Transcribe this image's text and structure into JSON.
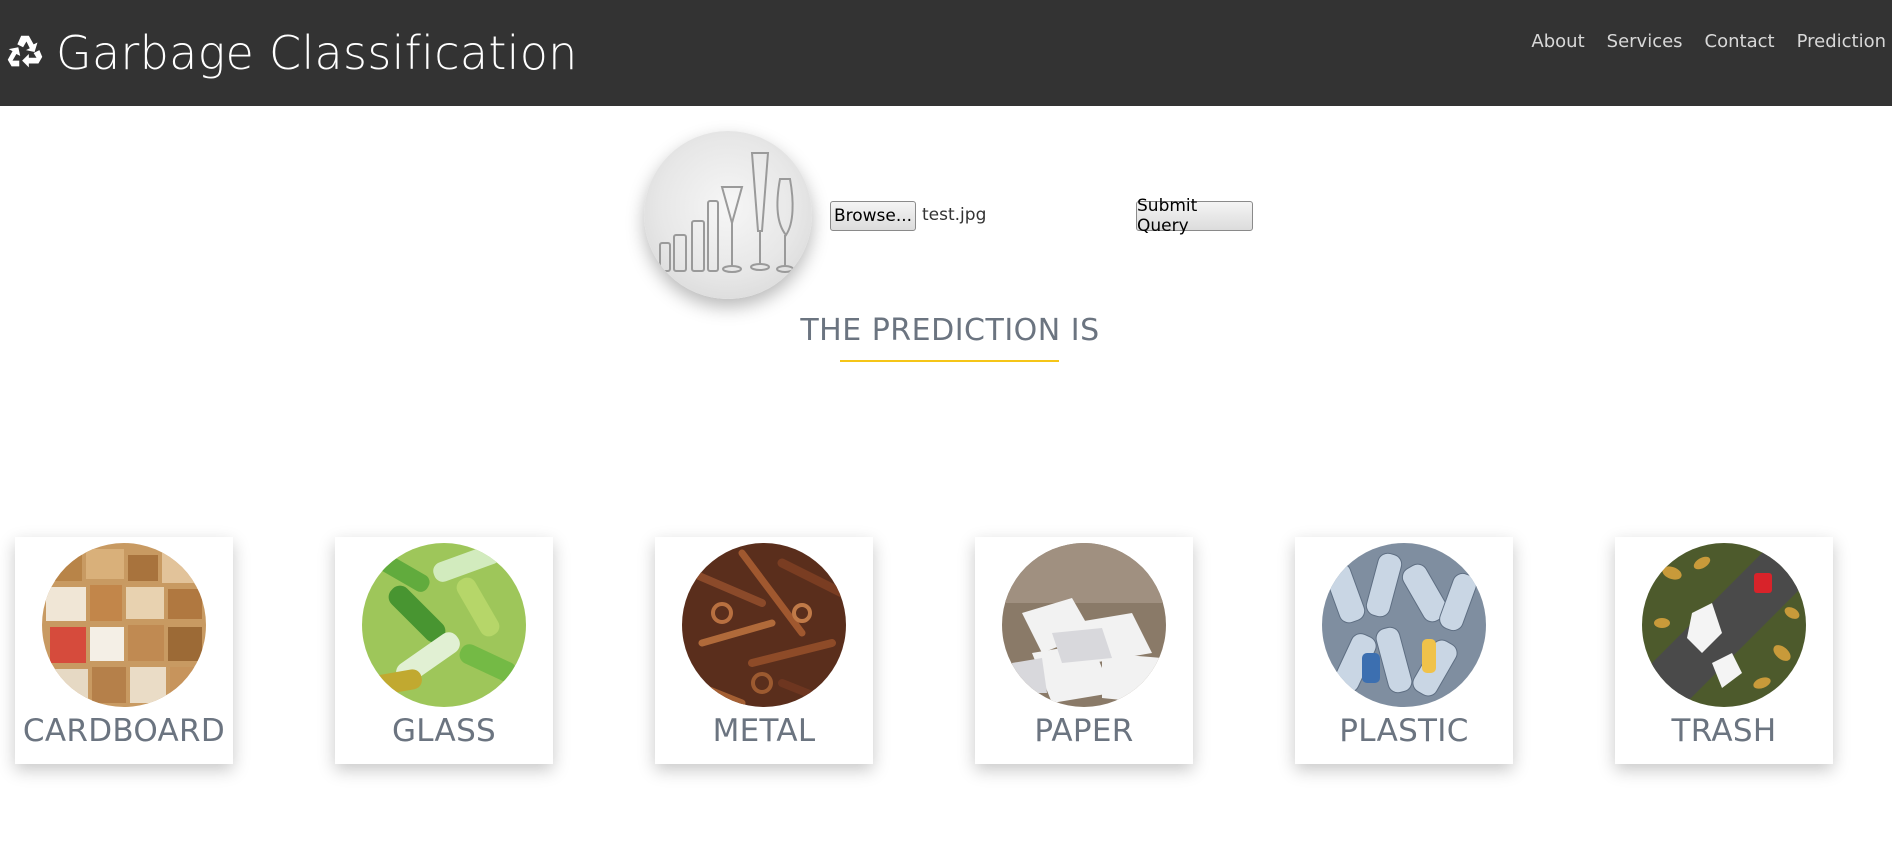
{
  "header": {
    "brand_title": "Garbage Classification",
    "logo_icon": "recycle-icon",
    "nav": [
      {
        "label": "About"
      },
      {
        "label": "Services"
      },
      {
        "label": "Contact"
      },
      {
        "label": "Prediction"
      }
    ]
  },
  "upload": {
    "preview_icon": "glassware-image",
    "browse_label": "Browse...",
    "file_name": "test.jpg",
    "submit_label": "Submit Query"
  },
  "prediction": {
    "heading": "THE PREDICTION IS",
    "result": ""
  },
  "colors": {
    "navbar_bg": "#333333",
    "accent_underline": "#f5c518",
    "heading_text": "#6b7480"
  },
  "categories": [
    {
      "label": "CARDBOARD",
      "image": "cardboard-image"
    },
    {
      "label": "GLASS",
      "image": "glass-image"
    },
    {
      "label": "METAL",
      "image": "metal-image"
    },
    {
      "label": "PAPER",
      "image": "paper-image"
    },
    {
      "label": "PLASTIC",
      "image": "plastic-image"
    },
    {
      "label": "TRASH",
      "image": "trash-image"
    }
  ]
}
